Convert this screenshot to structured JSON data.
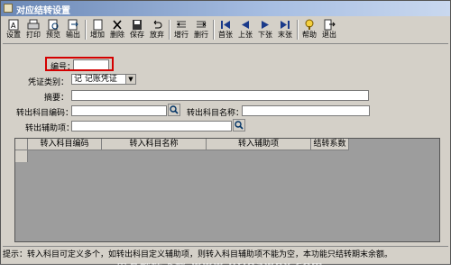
{
  "window": {
    "title": "对应结转设置"
  },
  "toolbar": {
    "set": "设置",
    "print": "打印",
    "preview": "预览",
    "export": "输出",
    "add": "增加",
    "delete": "删除",
    "save": "保存",
    "abandon": "放弃",
    "insert_row": "增行",
    "delete_row": "删行",
    "first": "首张",
    "prev": "上张",
    "next": "下张",
    "last": "末张",
    "help": "帮助",
    "exit": "退出"
  },
  "form": {
    "number_label": "编号：",
    "number_value": "",
    "voucher_type_label": "凭证类别：",
    "voucher_type_value": "记   记账凭证",
    "summary_label": "摘要：",
    "out_account_code_label": "转出科目编码：",
    "out_account_name_label": "转出科目名称：",
    "out_aux_label": "转出辅助项："
  },
  "grid": {
    "columns": [
      "转入科目编码",
      "转入科目名称",
      "转入辅助项",
      "结转系数"
    ]
  },
  "watermark": "用友软件下载 www.ufidawhy.com",
  "status_bar": "提示：转入科目可定义多个，如转出科目定义辅助项，则转入科目辅助项不能为空，本功能只结转期末余额。"
}
